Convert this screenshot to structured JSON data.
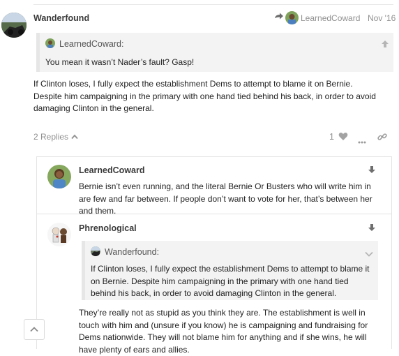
{
  "post": {
    "username": "Wanderfound",
    "reply_to_username": "LearnedCoward",
    "date": "Nov '16",
    "quote": {
      "username": "LearnedCoward:",
      "text": "You mean it wasn’t Nader’s fault? Gasp!"
    },
    "body": "If Clinton loses, I fully expect the establishment Dems to attempt to blame it on Bernie. Despite him campaigning in the primary with one hand tied behind his back, in order to avoid damaging Clinton in the general.",
    "replies_label": "2 Replies",
    "like_count": "1"
  },
  "replies": [
    {
      "username": "LearnedCoward",
      "body": "Bernie isn’t even running, and the literal Bernie Or Busters who will write him in are few and far between. If people don’t want to vote for her, that’s between her and them."
    },
    {
      "username": "Phrenological",
      "quote": {
        "username": "Wanderfound:",
        "text": "If Clinton loses, I fully expect the establishment Dems to attempt to blame it on Bernie. Despite him campaigning in the primary with one hand tied behind his back, in order to avoid damaging Clinton in the general."
      },
      "body": "They’re really not as stupid as you think they are. The establishment is well in touch with him and (unsure if you know) he is campaigning and fundraising for Dems nationwide. They will not blame him for anything and if she wins, he will have plenty of ears and allies."
    }
  ],
  "icons": {
    "reply_arrow": "reply-arrow-icon",
    "quote_up": "arrow-up-icon",
    "chevron_up": "chevron-up-icon",
    "heart": "heart-icon",
    "more": "ellipsis-icon",
    "link": "link-icon",
    "down_arrow": "arrow-down-icon",
    "chevron_down": "chevron-down-icon"
  },
  "colors": {
    "text": "#222222",
    "muted": "#919191",
    "quote_bg": "#f3f3f3",
    "quote_border": "#e6e6e6"
  }
}
